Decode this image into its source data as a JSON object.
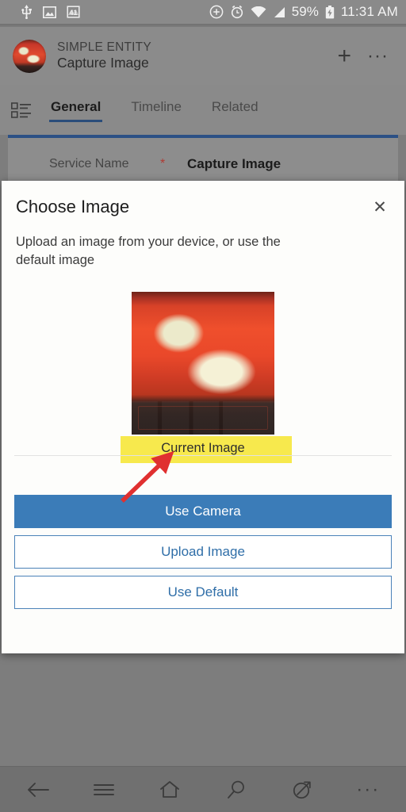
{
  "status_bar": {
    "left_icons": [
      {
        "name": "usb-icon",
        "glyph": "↧"
      },
      {
        "name": "screenshot-image-icon",
        "glyph": "ὛC"
      },
      {
        "name": "app-badge-41-icon",
        "label": "41"
      }
    ],
    "right_icons": [
      {
        "name": "do-not-disturb-icon"
      },
      {
        "name": "alarm-clock-icon"
      },
      {
        "name": "wifi-icon"
      },
      {
        "name": "cellular-signal-icon"
      }
    ],
    "battery_percent": "59%",
    "battery_state_icon": "battery-charging-icon",
    "time": "11:31 AM"
  },
  "app_header": {
    "entity_type": "SIMPLE ENTITY",
    "record_name": "Capture Image",
    "avatar_icon": "record-avatar",
    "new_label": "+",
    "more_label": "···"
  },
  "tabs": {
    "form_selector_icon": "form-selector-icon",
    "items": [
      {
        "label": "General",
        "active": true
      },
      {
        "label": "Timeline",
        "active": false
      },
      {
        "label": "Related",
        "active": false
      }
    ]
  },
  "record_form": {
    "field_label": "Service Name",
    "required_marker": "*",
    "field_value": "Capture Image"
  },
  "dialog": {
    "title": "Choose Image",
    "close_label": "✕",
    "description": "Upload an image from your device, or use the default image",
    "image_caption": "Current Image",
    "image_alt": "current-image-preview",
    "buttons": [
      {
        "label": "Use Camera",
        "style": "primary"
      },
      {
        "label": "Upload Image",
        "style": "outline"
      },
      {
        "label": "Use Default",
        "style": "outline"
      }
    ]
  },
  "annotations": {
    "highlight_color": "#F7E94D",
    "arrow_color": "#E03030",
    "highlight_target": "Current Image"
  },
  "bottom_nav": {
    "items": [
      {
        "name": "back-icon"
      },
      {
        "name": "menu-icon"
      },
      {
        "name": "home-icon"
      },
      {
        "name": "search-icon"
      },
      {
        "name": "share-icon"
      },
      {
        "name": "more-icon",
        "label": "···"
      }
    ]
  },
  "colors": {
    "accent": "#3B7CB8",
    "tab_underline": "#2A4D7A",
    "card_top_border": "#2C5085",
    "required_star": "#B03A33"
  }
}
